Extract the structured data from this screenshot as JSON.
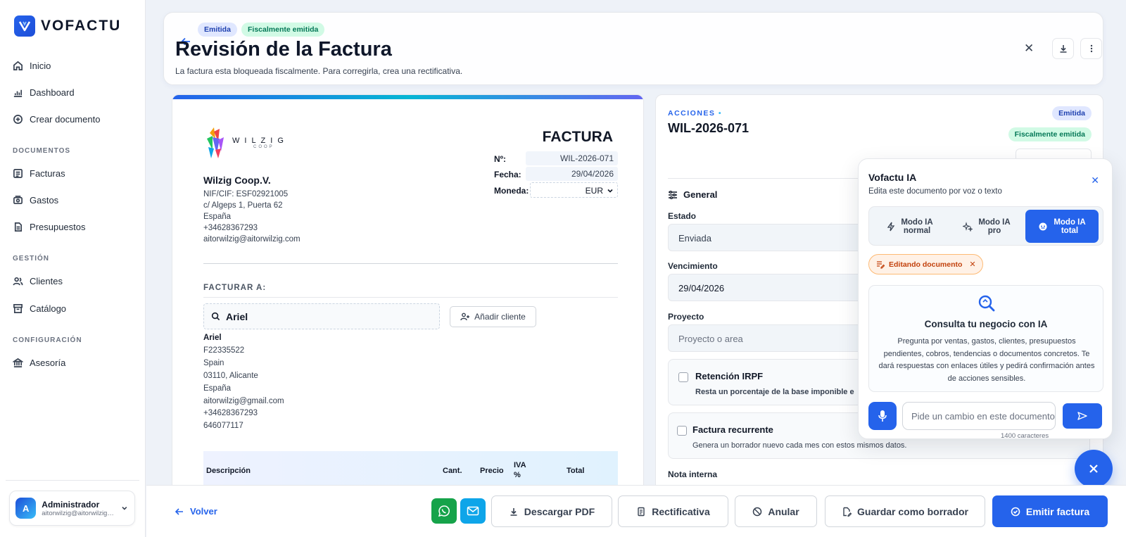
{
  "app": {
    "brand": "VOFACTU"
  },
  "sidebar": {
    "items": [
      {
        "label": "Inicio",
        "icon": "home-icon"
      },
      {
        "label": "Dashboard",
        "icon": "chart-icon"
      },
      {
        "label": "Crear documento",
        "icon": "plus-circle-icon"
      }
    ],
    "sections": [
      {
        "title": "DOCUMENTOS",
        "items": [
          {
            "label": "Facturas"
          },
          {
            "label": "Gastos"
          },
          {
            "label": "Presupuestos"
          }
        ]
      },
      {
        "title": "GESTIÓN",
        "items": [
          {
            "label": "Clientes"
          },
          {
            "label": "Catálogo"
          }
        ]
      },
      {
        "title": "CONFIGURACIÓN",
        "items": [
          {
            "label": "Asesoría"
          }
        ]
      }
    ],
    "user": {
      "initial": "A",
      "name": "Administrador",
      "email": "aitorwilzig@aitorwilzig.com"
    }
  },
  "header": {
    "badges": [
      "Emitida",
      "Fiscalmente emitida"
    ],
    "title": "Revisión de la Factura",
    "subtitle": "La factura esta bloqueada fiscalmente. Para corregirla, crea una rectificativa."
  },
  "invoice": {
    "logo_word": "WILZIG",
    "logo_sub": "COOP",
    "heading": "FACTURA",
    "company": {
      "name": "Wilzig Coop.V.",
      "lines": [
        "NIF/CIF: ESF02921005",
        "c/ Algeps 1, Puerta 62",
        "España",
        "+34628367293",
        "aitorwilzig@aitorwilzig.com"
      ]
    },
    "meta": {
      "num_label": "Nº:",
      "num_value": "WIL-2026-071",
      "date_label": "Fecha:",
      "date_value": "29/04/2026",
      "currency_label": "Moneda:",
      "currency_value": "EUR"
    },
    "bill_to": "FACTURAR A:",
    "client_search_value": "Ariel",
    "add_client_label": "Añadir cliente",
    "client": {
      "name": "Ariel",
      "lines": [
        "F22335522",
        "Spain",
        "03110, Alicante",
        "España",
        "aitorwilzig@gmail.com",
        "+34628367293",
        "646077117"
      ]
    },
    "table_headers": [
      "Descripción",
      "Cant.",
      "Precio",
      "IVA %",
      "Total"
    ]
  },
  "actions_panel": {
    "label": "ACCIONES",
    "doc_number": "WIL-2026-071",
    "badges": [
      "Emitida",
      "Fiscalmente emitida"
    ],
    "general_title": "General",
    "estado_label": "Estado",
    "estado_value": "Enviada",
    "vencimiento_label": "Vencimiento",
    "vencimiento_value": "29/04/2026",
    "proyecto_label": "Proyecto",
    "proyecto_placeholder": "Proyecto o area",
    "irpf_title": "Retención IRPF",
    "irpf_desc": "Resta un porcentaje de la base imponible e",
    "recurrente_title": "Factura recurrente",
    "recurrente_desc": "Genera un borrador nuevo cada mes con estos mismos datos.",
    "nota_label": "Nota interna"
  },
  "ai": {
    "title": "Vofactu IA",
    "subtitle": "Edita este documento por voz o texto",
    "modes": [
      {
        "line1": "Modo IA",
        "line2": "normal"
      },
      {
        "line1": "Modo IA",
        "line2": "pro"
      },
      {
        "line1": "Modo IA",
        "line2": "total"
      }
    ],
    "chip": "Editando documento",
    "info_title": "Consulta tu negocio con IA",
    "info_text": "Pregunta por ventas, gastos, clientes, presupuestos pendientes, cobros, tendencias o documentos concretos. Te dará respuestas con enlaces útiles y pedirá confirmación antes de acciones sensibles.",
    "input_placeholder": "Pide un cambio en este documento",
    "char_count": "1400 caracteres"
  },
  "bottom": {
    "back": "Volver",
    "download": "Descargar PDF",
    "rectificativa": "Rectificativa",
    "anular": "Anular",
    "draft": "Guardar como borrador",
    "emit": "Emitir factura"
  },
  "colors": {
    "accent": "#2563eb",
    "whatsapp": "#16a34a",
    "mail": "#0ea5e9"
  }
}
